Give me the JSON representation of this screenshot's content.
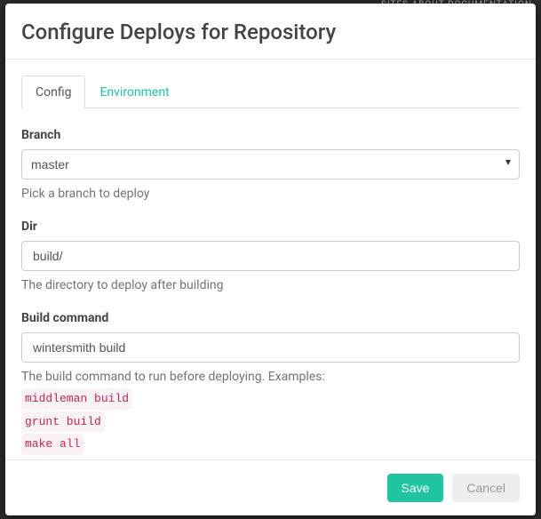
{
  "backdrop": {
    "nav_items": "SITES        ABOUT        DOCUMENTATION"
  },
  "modal": {
    "title": "Configure Deploys for Repository"
  },
  "tabs": {
    "config": "Config",
    "environment": "Environment"
  },
  "form": {
    "branch": {
      "label": "Branch",
      "value": "master",
      "help": "Pick a branch to deploy"
    },
    "dir": {
      "label": "Dir",
      "value": "build/",
      "help": "The directory to deploy after building"
    },
    "build_command": {
      "label": "Build command",
      "value": "wintersmith build",
      "help": "The build command to run before deploying. Examples:",
      "examples": {
        "ex1": "middleman build",
        "ex2": "grunt build",
        "ex3": "make all"
      }
    }
  },
  "footer": {
    "save": "Save",
    "cancel": "Cancel"
  }
}
